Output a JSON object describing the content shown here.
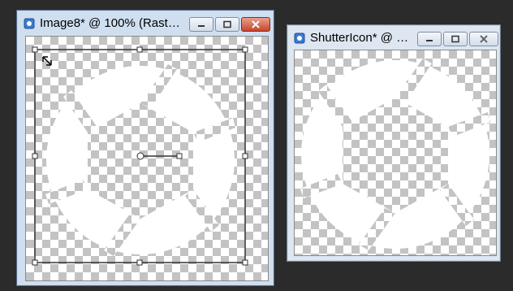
{
  "windows": [
    {
      "title": "Image8* @ 100% (Raster ...",
      "active": true,
      "icons": {
        "app": "document-icon",
        "minimize": "minimize-icon",
        "maximize": "maximize-icon",
        "close": "close-icon"
      }
    },
    {
      "title": "ShutterIcon* @ 10...",
      "active": false,
      "icons": {
        "app": "document-icon",
        "minimize": "minimize-icon",
        "maximize": "maximize-icon",
        "close": "close-icon"
      }
    }
  ],
  "colors": {
    "desktop": "#2b2b2b",
    "checker_dark": "#c3c3c3",
    "checker_light": "#ffffff",
    "shutter_blade": "#ffffff",
    "close_button": "#c6452d"
  },
  "canvas_content": "camera-shutter-icon"
}
